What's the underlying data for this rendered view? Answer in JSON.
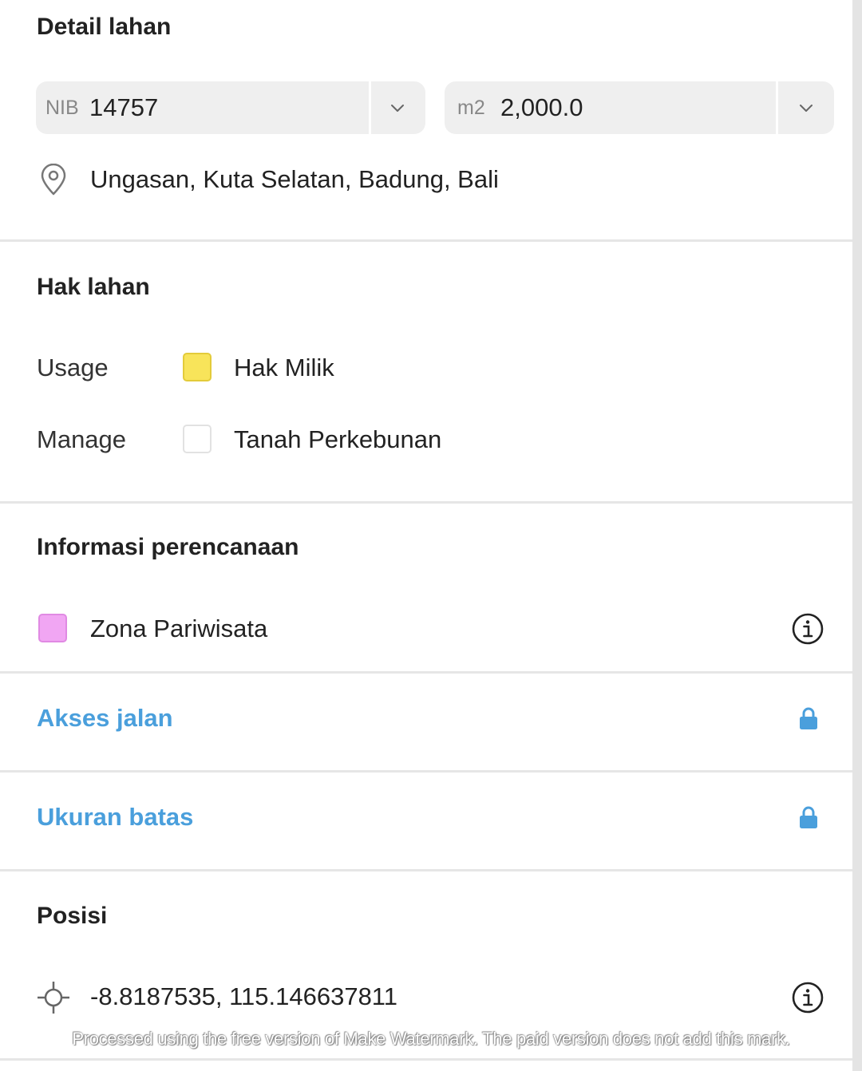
{
  "detail": {
    "title": "Detail lahan",
    "nib_prefix": "NIB",
    "nib_value": "14757",
    "area_prefix": "m2",
    "area_value": "2,000.0",
    "location": "Ungasan, Kuta Selatan, Badung, Bali"
  },
  "hak": {
    "title": "Hak lahan",
    "rows": [
      {
        "label": "Usage",
        "value": "Hak Milik",
        "color": "#f8e45a"
      },
      {
        "label": "Manage",
        "value": "Tanah Perkebunan",
        "color": "#ffffff"
      }
    ]
  },
  "planning": {
    "title": "Informasi perencanaan",
    "zone": "Zona Pariwisata",
    "zone_color": "#f1a6f3",
    "info_icon": "info-icon"
  },
  "locked_sections": [
    {
      "title": "Akses jalan",
      "icon": "lock-icon"
    },
    {
      "title": "Ukuran batas",
      "icon": "lock-icon"
    }
  ],
  "position": {
    "title": "Posisi",
    "coordinates": "-8.8187535, 115.146637811",
    "icon": "crosshair-icon"
  },
  "accent_color": "#4a9fdc",
  "watermark": "Processed using the free version of Make Watermark. The paid version does not add this mark."
}
